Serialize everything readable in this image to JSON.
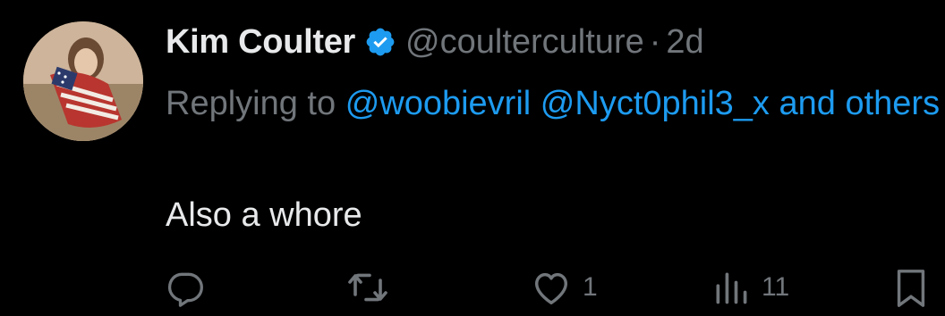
{
  "tweet": {
    "display_name": "Kim Coulter",
    "handle": "@coulterculture",
    "separator": "·",
    "time": "2d",
    "reply_prefix": "Replying to",
    "mentions": [
      "@woobievril",
      "@Nyct0phil3_x"
    ],
    "reply_suffix_word": "and",
    "others_text": "others",
    "body": "Also a whore",
    "stats": {
      "likes": "1",
      "views": "11"
    }
  },
  "colors": {
    "background": "#000000",
    "primary_text": "#e7e9ea",
    "secondary_text": "#71767b",
    "accent": "#1d9bf0"
  },
  "icons": {
    "verified": "verified-badge-icon",
    "reply": "reply-icon",
    "retweet": "retweet-icon",
    "like": "heart-icon",
    "views": "views-chart-icon",
    "bookmark": "bookmark-icon"
  }
}
